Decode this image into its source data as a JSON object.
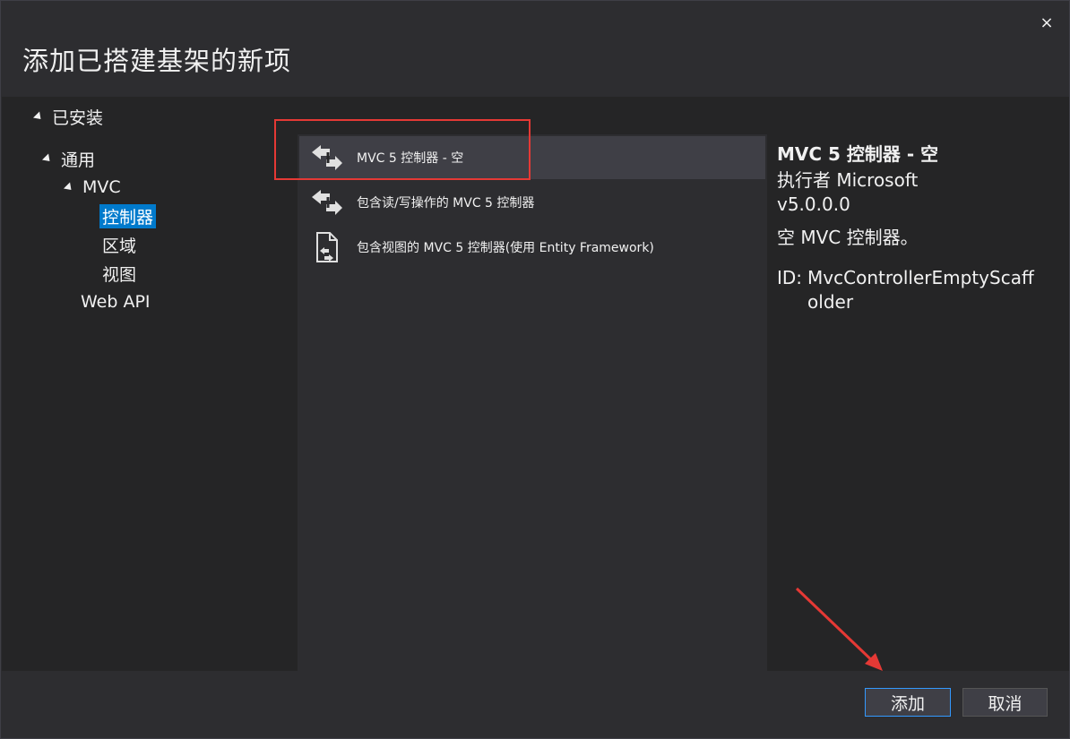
{
  "dialog": {
    "title": "添加已搭建基架的新项",
    "close_glyph": "×"
  },
  "tree": {
    "installed": "已安装",
    "common": "通用",
    "mvc": "MVC",
    "controller": "控制器",
    "area": "区域",
    "view": "视图",
    "webapi": "Web API"
  },
  "list": {
    "items": [
      {
        "label": "MVC 5 控制器 - 空",
        "icon": "scaffold-arrow-icon"
      },
      {
        "label": "包含读/写操作的 MVC 5 控制器",
        "icon": "scaffold-arrow-icon"
      },
      {
        "label": "包含视图的 MVC 5 控制器(使用 Entity Framework)",
        "icon": "document-scaffold-icon"
      }
    ]
  },
  "details": {
    "name": "MVC 5 控制器 - 空",
    "author": "执行者 Microsoft",
    "version": "v5.0.0.0",
    "description": "空 MVC 控制器。",
    "id_label": "ID:",
    "id_value": "MvcControllerEmptyScaffolder"
  },
  "buttons": {
    "add": "添加",
    "cancel": "取消"
  },
  "colors": {
    "accent": "#007acc",
    "annotation": "#e53935"
  }
}
